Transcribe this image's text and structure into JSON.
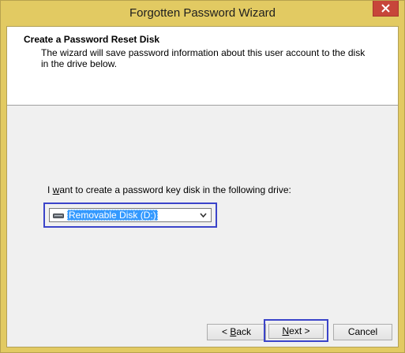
{
  "window": {
    "title": "Forgotten Password Wizard"
  },
  "header": {
    "title": "Create a Password Reset Disk",
    "subtitle": "The wizard will save password information about this user account to the disk in the drive below."
  },
  "body": {
    "prompt_prefix": "I ",
    "prompt_accel": "w",
    "prompt_rest": "ant to create a password key disk in the following drive:",
    "drive_select": {
      "selected": "Removable Disk (D:)",
      "icon": "removable-drive-icon"
    }
  },
  "buttons": {
    "back_accel": "< ",
    "back_ul": "B",
    "back_rest": "ack",
    "next_ul": "N",
    "next_rest": "ext >",
    "cancel": "Cancel"
  },
  "colors": {
    "frame": "#e2ca62",
    "close_button": "#c7463a",
    "focus_border": "#3b44c9",
    "selection": "#3399ff"
  }
}
